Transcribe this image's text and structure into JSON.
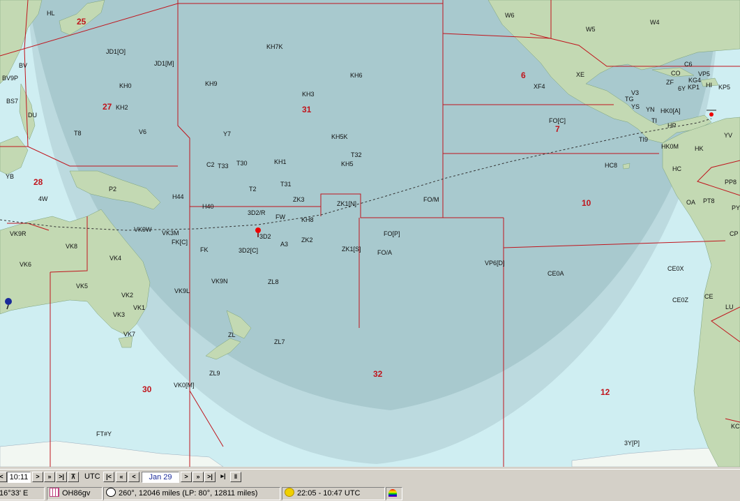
{
  "map": {
    "cq_zones": [
      {
        "id": "25",
        "text": "25"
      },
      {
        "id": "27",
        "text": "27"
      },
      {
        "id": "31",
        "text": "31"
      },
      {
        "id": "6",
        "text": "6"
      },
      {
        "id": "7",
        "text": "7"
      },
      {
        "id": "28",
        "text": "28"
      },
      {
        "id": "10",
        "text": "10"
      },
      {
        "id": "32",
        "text": "32"
      },
      {
        "id": "30",
        "text": "30"
      },
      {
        "id": "12",
        "text": "12"
      }
    ],
    "prefixes": [
      "HL",
      "BV",
      "BV9P",
      "BS7",
      "DU",
      "YB",
      "4W",
      "VK9R",
      "VK6",
      "VK8",
      "VK4",
      "VK5",
      "VK2",
      "VK1",
      "VK3",
      "VK7",
      "JD1[O]",
      "JD1[M]",
      "KH0",
      "KH2",
      "T8",
      "V6",
      "P2",
      "H44",
      "H40",
      "VK9W",
      "VK3M",
      "FK[C]",
      "FK",
      "VK9N",
      "VK9L",
      "ZL9",
      "VK0[M]",
      "FT#Y",
      "KH7K",
      "KH9",
      "KH6",
      "KH3",
      "Y7",
      "KH5K",
      "T32",
      "KH1",
      "KH5",
      "C2",
      "T33",
      "T30",
      "T31",
      "T2",
      "ZK3",
      "3D2/R",
      "FW",
      "KH8",
      "ZK1[N]",
      "3D2",
      "3D2[C]",
      "A3",
      "ZK2",
      "ZK1[S]",
      "FO[P]",
      "FO/A",
      "FO/M",
      "ZL8",
      "ZL",
      "ZL7",
      "W6",
      "W5",
      "W4",
      "VP5",
      "XE",
      "XF4",
      "C6",
      "CO",
      "ZF",
      "KG4",
      "6Y",
      "KP1",
      "KP5",
      "HI",
      "V3",
      "TG",
      "YN",
      "HK0[A]",
      "TI",
      "HP",
      "FO[C]",
      "TI9",
      "HK0M",
      "HK",
      "HC",
      "HC8",
      "YV",
      "PP8",
      "OA",
      "PT8",
      "VP6[D]",
      "CE0A",
      "CE0X",
      "CE0Z",
      "CE",
      "LU",
      "3Y[P]",
      "KC",
      "CP",
      "YS",
      "PY"
    ],
    "home_marker": "home-qth-pin",
    "target_marker": "target-pin",
    "colors": {
      "ocean_lit": "#cfeef2",
      "ocean_dark": "#a8cdd1",
      "land": "#c0dcb0",
      "zone_lines": "#c0141c",
      "grayline": "#8fb2b6"
    }
  },
  "toolbar": {
    "time_value": "10:11",
    "utc_label": "UTC",
    "date_value": "Jan 29",
    "nav_prev": "<",
    "nav_next": ">"
  },
  "status": {
    "coords": "16°33' E",
    "locator": "OH86gv",
    "bearing": "260°, 12046 miles  (LP: 80°, 12811 miles)",
    "sun": "22:05 - 10:47 UTC"
  }
}
